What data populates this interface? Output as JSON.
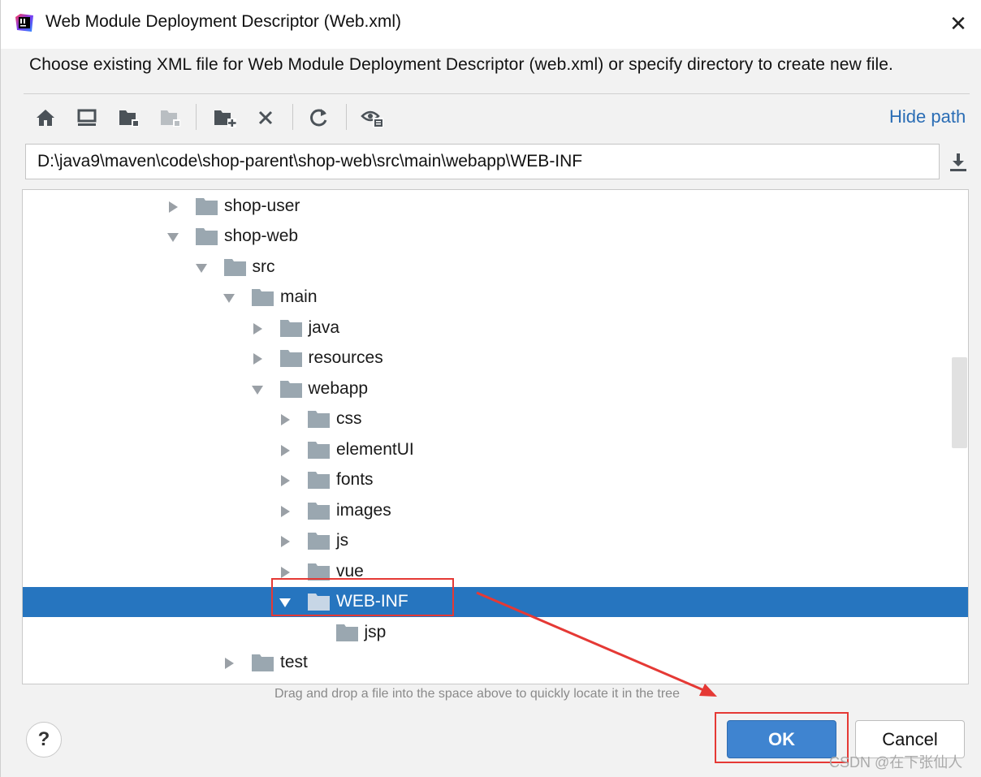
{
  "window": {
    "title": "Web Module Deployment Descriptor (Web.xml)",
    "close_glyph": "✕"
  },
  "description": "Choose existing XML file for Web Module Deployment Descriptor (web.xml) or specify directory to create new file.",
  "toolbar": {
    "buttons": [
      "home-icon",
      "desktop-icon",
      "project-folder-icon",
      "module-folder-icon",
      "new-folder-icon",
      "delete-icon",
      "refresh-icon",
      "show-hidden-icon"
    ],
    "hide_path_label": "Hide path"
  },
  "path": {
    "value": "D:\\java9\\maven\\code\\shop-parent\\shop-web\\src\\main\\webapp\\WEB-INF",
    "download_icon": "download-icon"
  },
  "tree": {
    "items": [
      {
        "label": "shop-user",
        "expanded": false
      },
      {
        "label": "shop-web",
        "expanded": true
      },
      {
        "label": "src",
        "expanded": true
      },
      {
        "label": "main",
        "expanded": true
      },
      {
        "label": "java",
        "expanded": false
      },
      {
        "label": "resources",
        "expanded": false
      },
      {
        "label": "webapp",
        "expanded": true
      },
      {
        "label": "css",
        "expanded": false
      },
      {
        "label": "elementUI",
        "expanded": false
      },
      {
        "label": "fonts",
        "expanded": false
      },
      {
        "label": "images",
        "expanded": false
      },
      {
        "label": "js",
        "expanded": false
      },
      {
        "label": "vue",
        "expanded": false
      },
      {
        "label": "WEB-INF",
        "expanded": true,
        "selected": true
      },
      {
        "label": "jsp",
        "expanded": false,
        "leaf": true
      },
      {
        "label": "test",
        "expanded": false
      }
    ]
  },
  "hint": "Drag and drop a file into the space above to quickly locate it in the tree",
  "buttons": {
    "help": "?",
    "ok": "OK",
    "cancel": "Cancel"
  },
  "colors": {
    "selection": "#2675bf",
    "link": "#2a6db5",
    "annotation": "#e53935",
    "folder": "#9aa7b0"
  },
  "watermark": "CSDN @在下张仙人"
}
